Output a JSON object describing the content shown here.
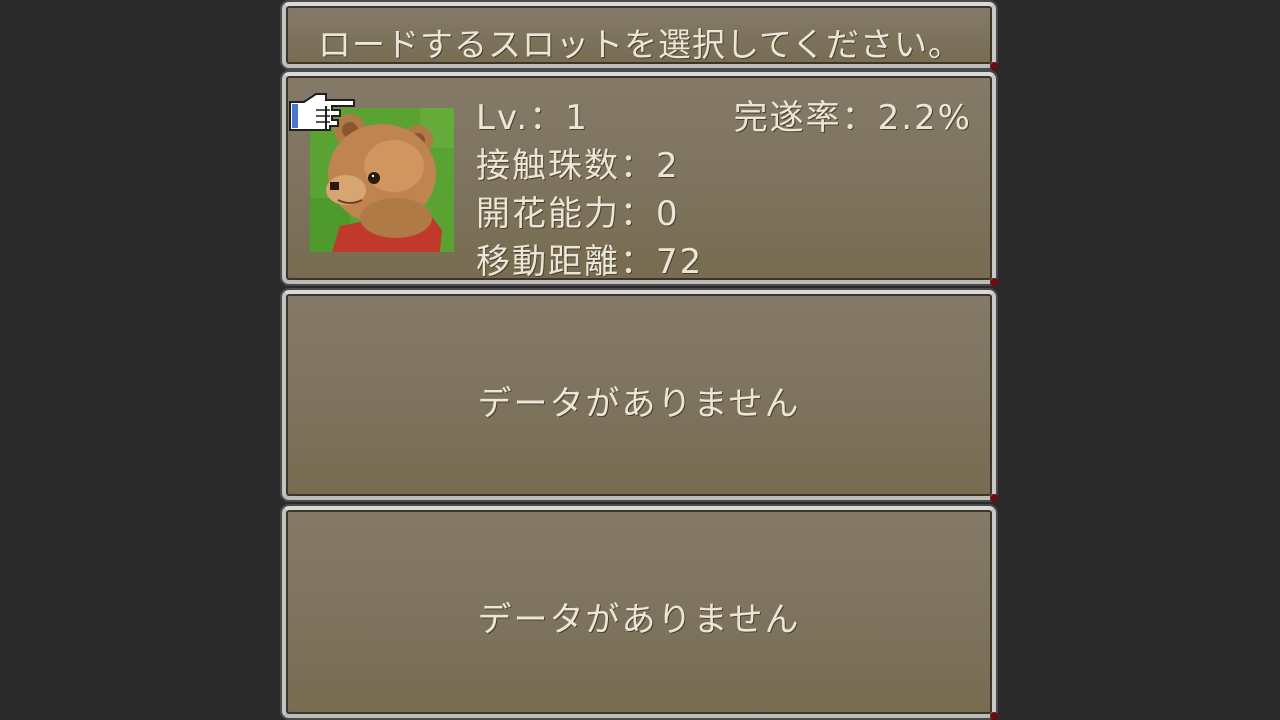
{
  "help": {
    "text": "ロードするスロットを選択してください。"
  },
  "slots": [
    {
      "level": "Lv.：1",
      "completion": "完遂率：2.2%",
      "contact_beads": "接触珠数：2",
      "bloom_ability": "開花能力：0",
      "move_distance": "移動距離：72",
      "portrait": "bear-portrait"
    },
    {
      "empty_text": "データがありません"
    },
    {
      "empty_text": "データがありません"
    }
  ],
  "cursor": {
    "icon": "pointing-hand-icon",
    "selected_slot": 1
  },
  "colors": {
    "background": "#2a2a2a",
    "window_top": "#847a67",
    "window_bottom": "#776b50",
    "text": "#ece6d6",
    "frame": "#d9d9d9",
    "corner_gem": "#6a0d0d"
  }
}
